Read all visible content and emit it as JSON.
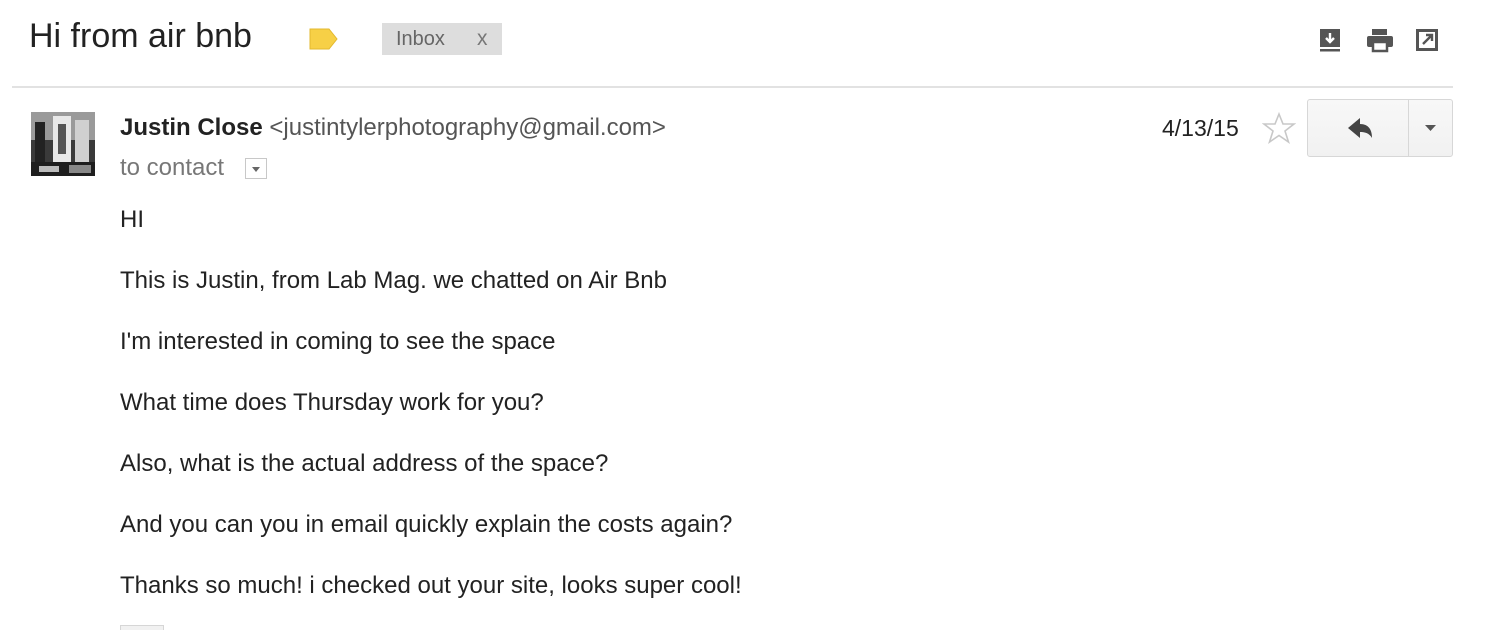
{
  "header": {
    "subject": "Hi from air bnb",
    "label_chip": "Inbox",
    "label_chip_close": "x",
    "icons": [
      "download-icon",
      "print-icon",
      "new-window-icon"
    ],
    "label_color": "#f7d046"
  },
  "message": {
    "sender_name": "Justin Close",
    "sender_email": "<justintylerphotography@gmail.com>",
    "to_line": "to contact",
    "date": "4/13/15",
    "body_lines": [
      "HI",
      "This is Justin, from Lab Mag. we chatted on Air Bnb",
      "I'm interested in coming to see the space",
      "What time does Thursday work for you?",
      "Also, what is the actual address of the space?",
      "And you can you in email quickly explain the costs again?",
      "Thanks so much! i checked out your site, looks super cool!"
    ]
  },
  "actions": {
    "reply_icon": "reply-icon",
    "more_icon": "chevron-down-icon",
    "star_icon": "star-icon"
  }
}
